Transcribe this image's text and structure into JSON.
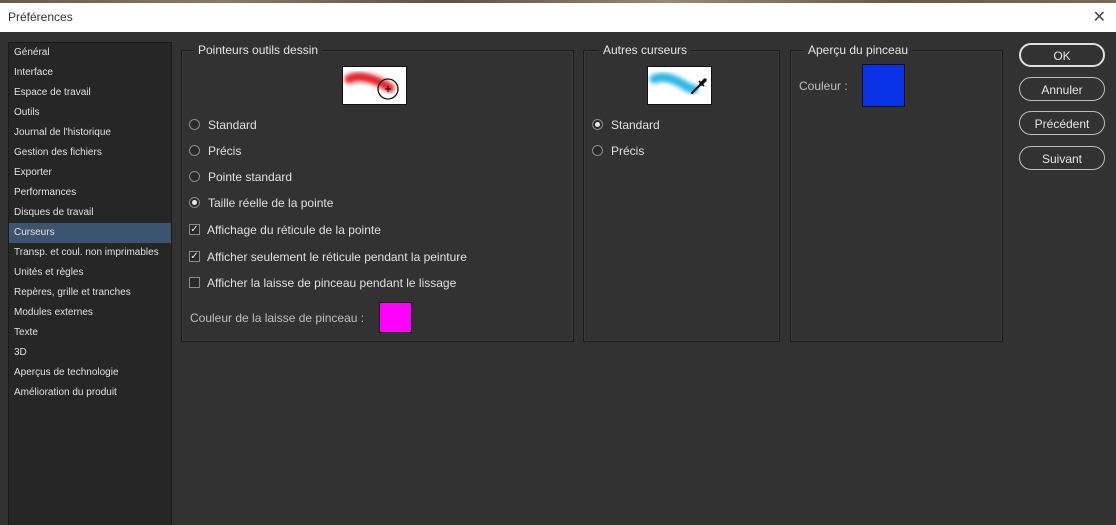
{
  "window": {
    "title": "Préférences"
  },
  "sidebar": {
    "items": [
      {
        "label": "Général"
      },
      {
        "label": "Interface"
      },
      {
        "label": "Espace de travail"
      },
      {
        "label": "Outils"
      },
      {
        "label": "Journal de l'historique"
      },
      {
        "label": "Gestion des fichiers"
      },
      {
        "label": "Exporter"
      },
      {
        "label": "Performances"
      },
      {
        "label": "Disques de travail"
      },
      {
        "label": "Curseurs"
      },
      {
        "label": "Transp. et coul. non imprimables"
      },
      {
        "label": "Unités et règles"
      },
      {
        "label": "Repères, grille et tranches"
      },
      {
        "label": "Modules externes"
      },
      {
        "label": "Texte"
      },
      {
        "label": "3D"
      },
      {
        "label": "Aperçus de technologie"
      },
      {
        "label": "Amélioration du produit"
      }
    ],
    "selected": "Curseurs"
  },
  "painting_cursors": {
    "title": "Pointeurs outils dessin",
    "options": [
      {
        "label": "Standard",
        "checked": false
      },
      {
        "label": "Précis",
        "checked": false
      },
      {
        "label": "Pointe standard",
        "checked": false
      },
      {
        "label": "Taille réelle de la pointe",
        "checked": true
      }
    ],
    "checkboxes": [
      {
        "label": "Affichage du réticule de la pointe",
        "checked": true
      },
      {
        "label": "Afficher seulement le réticule pendant la peinture",
        "checked": true
      },
      {
        "label": "Afficher la laisse de pinceau pendant le lissage",
        "checked": false
      }
    ],
    "leash_color_label": "Couleur de la laisse de pinceau :",
    "leash_color": "#ff00ff"
  },
  "other_cursors": {
    "title": "Autres curseurs",
    "options": [
      {
        "label": "Standard",
        "checked": true
      },
      {
        "label": "Précis",
        "checked": false
      }
    ]
  },
  "brush_preview": {
    "title": "Aperçu du pinceau",
    "color_label": "Couleur :",
    "color": "#0a32e6"
  },
  "buttons": {
    "ok": "OK",
    "cancel": "Annuler",
    "previous": "Précédent",
    "next": "Suivant"
  }
}
